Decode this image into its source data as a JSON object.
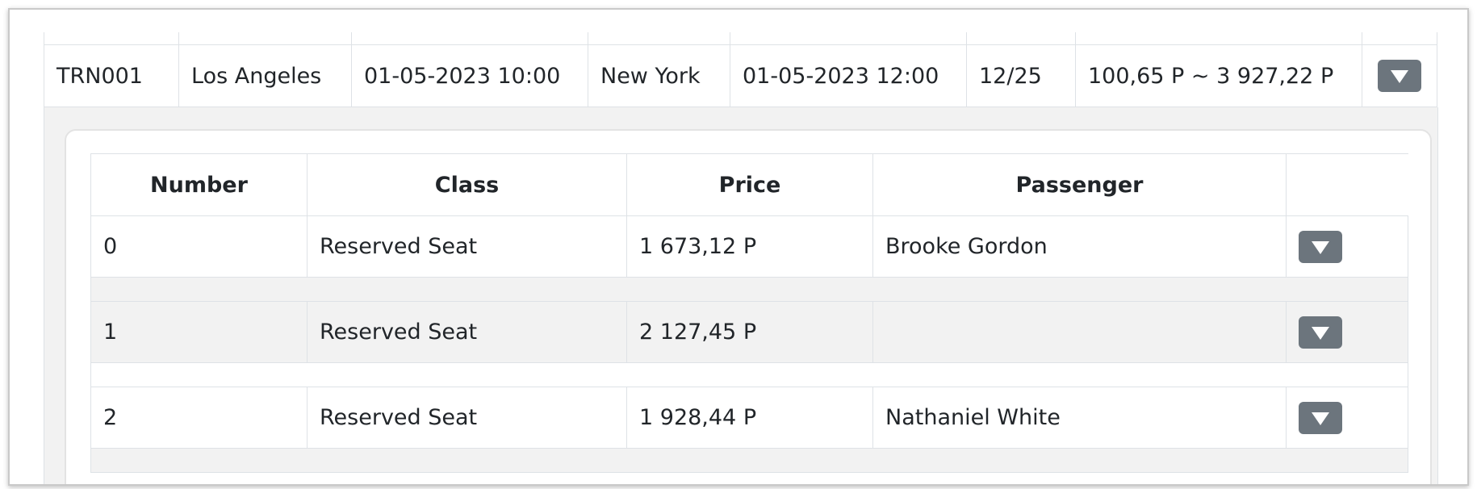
{
  "trip": {
    "code": "TRN001",
    "origin": "Los Angeles",
    "departure": "01-05-2023 10:00",
    "destination": "New York",
    "arrival": "01-05-2023 12:00",
    "seats": "12/25",
    "price_range": "100,65 P ~ 3 927,22 P"
  },
  "tickets": {
    "headers": {
      "number": "Number",
      "class": "Class",
      "price": "Price",
      "passenger": "Passenger"
    },
    "rows": [
      {
        "number": "0",
        "class": "Reserved Seat",
        "price": "1 673,12 P",
        "passenger": "Brooke Gordon"
      },
      {
        "number": "1",
        "class": "Reserved Seat",
        "price": "2 127,45 P",
        "passenger": ""
      },
      {
        "number": "2",
        "class": "Reserved Seat",
        "price": "1 928,44 P",
        "passenger": "Nathaniel White"
      }
    ]
  },
  "icons": {
    "expand": "caret-down-icon"
  },
  "colors": {
    "button_bg": "#6c757d",
    "detail_bg": "#f2f2f2",
    "border": "#dee2e6"
  }
}
